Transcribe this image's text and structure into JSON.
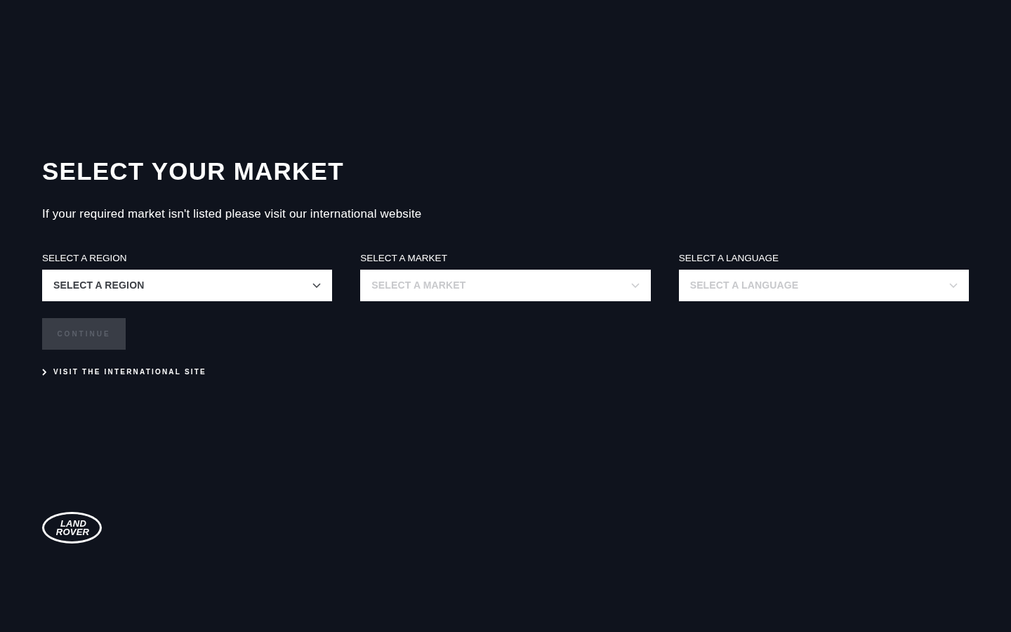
{
  "heading": "SELECT YOUR MARKET",
  "intro": "If your required market isn't listed please visit our international website",
  "selects": [
    {
      "label": "SELECT A REGION",
      "placeholder": "SELECT A REGION",
      "disabled": false
    },
    {
      "label": "SELECT A MARKET",
      "placeholder": "SELECT A MARKET",
      "disabled": true
    },
    {
      "label": "SELECT A LANGUAGE",
      "placeholder": "SELECT A LANGUAGE",
      "disabled": true
    }
  ],
  "continue_button": {
    "label": "CONTINUE",
    "disabled": true
  },
  "international_link": {
    "label": "VISIT THE INTERNATIONAL SITE"
  },
  "logo": {
    "line_1": "LAND",
    "line_2": "ROVER"
  }
}
